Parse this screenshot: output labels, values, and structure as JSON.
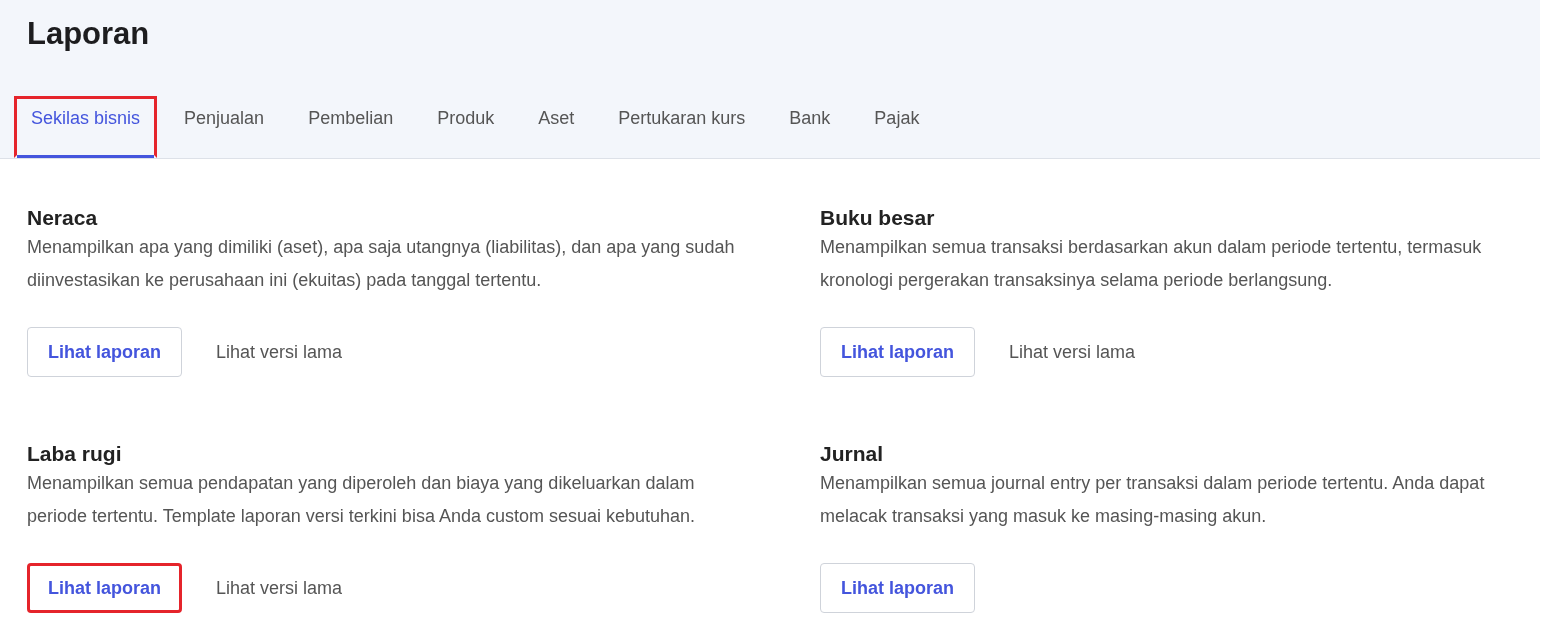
{
  "page": {
    "title": "Laporan"
  },
  "tabs": [
    {
      "label": "Sekilas bisnis",
      "selected": true,
      "highlighted": true
    },
    {
      "label": "Penjualan",
      "selected": false,
      "highlighted": false
    },
    {
      "label": "Pembelian",
      "selected": false,
      "highlighted": false
    },
    {
      "label": "Produk",
      "selected": false,
      "highlighted": false
    },
    {
      "label": "Aset",
      "selected": false,
      "highlighted": false
    },
    {
      "label": "Pertukaran kurs",
      "selected": false,
      "highlighted": false
    },
    {
      "label": "Bank",
      "selected": false,
      "highlighted": false
    },
    {
      "label": "Pajak",
      "selected": false,
      "highlighted": false
    }
  ],
  "reports": [
    {
      "title": "Neraca",
      "description": "Menampilkan apa yang dimiliki (aset), apa saja utangnya (liabilitas), dan apa yang sudah diinvestasikan ke perusahaan ini (ekuitas) pada tanggal tertentu.",
      "button": {
        "label": "Lihat laporan",
        "highlighted": false
      },
      "old_version_link": "Lihat versi lama"
    },
    {
      "title": "Buku besar",
      "description": "Menampilkan semua transaksi berdasarkan akun dalam periode tertentu, termasuk kronologi pergerakan transaksinya selama periode berlangsung.",
      "button": {
        "label": "Lihat laporan",
        "highlighted": false
      },
      "old_version_link": "Lihat versi lama"
    },
    {
      "title": "Laba rugi",
      "description": "Menampilkan semua pendapatan yang diperoleh dan biaya yang dikeluarkan dalam periode tertentu. Template laporan versi terkini bisa Anda custom sesuai kebutuhan.",
      "button": {
        "label": "Lihat laporan",
        "highlighted": true
      },
      "old_version_link": "Lihat versi lama"
    },
    {
      "title": "Jurnal",
      "description": "Menampilkan semua journal entry per transaksi dalam periode tertentu. Anda dapat melacak transaksi yang masuk ke masing-masing akun.",
      "button": {
        "label": "Lihat laporan",
        "highlighted": false
      }
    }
  ]
}
